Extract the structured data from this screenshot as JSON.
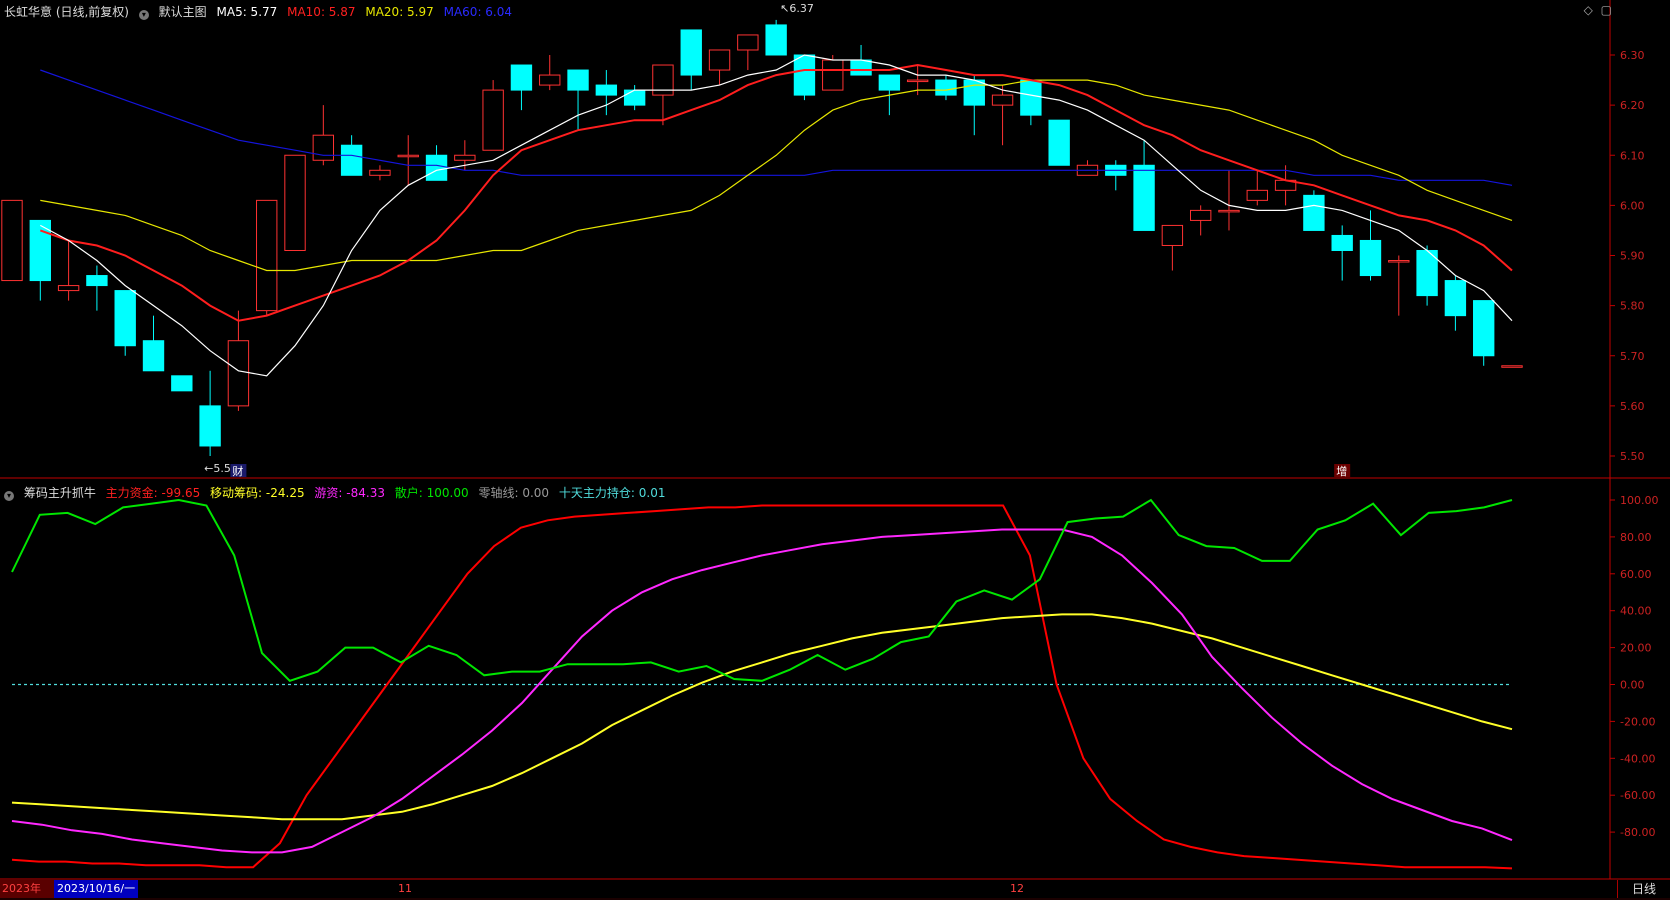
{
  "main_header": {
    "title": "长虹华意 (日线,前复权)",
    "indicator": "默认主图",
    "ma5": "MA5: 5.77",
    "ma10": "MA10: 5.87",
    "ma20": "MA20: 5.97",
    "ma60": "MA60: 6.04"
  },
  "sub_header": {
    "name": "筹码主升抓牛",
    "main_fund": "主力资金: -99.65",
    "moving_chips": "移动筹码: -24.25",
    "hot_money": "游资: -84.33",
    "retail": "散户: 100.00",
    "zero_line": "零轴线: 0.00",
    "ten_day_hold": "十天主力持仓: 0.01"
  },
  "corner_icons": [
    "diamond-icon",
    "square-icon"
  ],
  "date_band": {
    "year": "2023年",
    "cursor_date": "2023/10/16/一",
    "month_11": "11",
    "month_12": "12"
  },
  "period_label": "日线",
  "colors": {
    "up": "#ff3232",
    "down": "#00ffff",
    "ma5": "#ffffff",
    "ma10": "#ff1e1e",
    "ma20": "#e6e600",
    "ma60": "#1414dc",
    "main_fund": "#ff0000",
    "moving_chips": "#ffff28",
    "hot_money": "#ff28ff",
    "retail": "#00e600",
    "zero_line": "#50dcdc",
    "axis": "#c00000"
  },
  "chart_data": [
    {
      "type": "candlestick",
      "price_axis": {
        "min": 5.45,
        "max": 6.37,
        "ticks": [
          "6.30",
          "6.20",
          "6.10",
          "6.00",
          "5.90",
          "5.80",
          "5.70",
          "5.60",
          "5.50"
        ]
      },
      "annotations": {
        "high": "6.37",
        "low": "5.50",
        "event_caicai": "财",
        "event_zeng": "增"
      },
      "candles": [
        {
          "o": 5.85,
          "h": 5.97,
          "l": 5.85,
          "c": 6.01
        },
        {
          "o": 5.97,
          "h": 5.97,
          "l": 5.81,
          "c": 5.85
        },
        {
          "o": 5.83,
          "h": 5.93,
          "l": 5.81,
          "c": 5.84
        },
        {
          "o": 5.86,
          "h": 5.88,
          "l": 5.79,
          "c": 5.84
        },
        {
          "o": 5.83,
          "h": 5.83,
          "l": 5.7,
          "c": 5.72
        },
        {
          "o": 5.73,
          "h": 5.78,
          "l": 5.68,
          "c": 5.67
        },
        {
          "o": 5.66,
          "h": 5.66,
          "l": 5.63,
          "c": 5.63
        },
        {
          "o": 5.6,
          "h": 5.67,
          "l": 5.5,
          "c": 5.52
        },
        {
          "o": 5.6,
          "h": 5.79,
          "l": 5.59,
          "c": 5.73
        },
        {
          "o": 5.79,
          "h": 6.0,
          "l": 5.78,
          "c": 6.01
        },
        {
          "o": 5.91,
          "h": 6.1,
          "l": 5.91,
          "c": 6.1
        },
        {
          "o": 6.09,
          "h": 6.2,
          "l": 6.08,
          "c": 6.14
        },
        {
          "o": 6.12,
          "h": 6.14,
          "l": 6.06,
          "c": 6.06
        },
        {
          "o": 6.06,
          "h": 6.08,
          "l": 6.05,
          "c": 6.07
        },
        {
          "o": 6.1,
          "h": 6.14,
          "l": 6.04,
          "c": 6.1
        },
        {
          "o": 6.1,
          "h": 6.12,
          "l": 6.05,
          "c": 6.05
        },
        {
          "o": 6.09,
          "h": 6.13,
          "l": 6.07,
          "c": 6.1
        },
        {
          "o": 6.11,
          "h": 6.25,
          "l": 6.11,
          "c": 6.23
        },
        {
          "o": 6.28,
          "h": 6.28,
          "l": 6.19,
          "c": 6.23
        },
        {
          "o": 6.24,
          "h": 6.3,
          "l": 6.23,
          "c": 6.26
        },
        {
          "o": 6.27,
          "h": 6.26,
          "l": 6.15,
          "c": 6.23
        },
        {
          "o": 6.24,
          "h": 6.27,
          "l": 6.18,
          "c": 6.22
        },
        {
          "o": 6.23,
          "h": 6.24,
          "l": 6.19,
          "c": 6.2
        },
        {
          "o": 6.22,
          "h": 6.27,
          "l": 6.16,
          "c": 6.28
        },
        {
          "o": 6.35,
          "h": 6.35,
          "l": 6.23,
          "c": 6.26
        },
        {
          "o": 6.27,
          "h": 6.31,
          "l": 6.24,
          "c": 6.31
        },
        {
          "o": 6.31,
          "h": 6.34,
          "l": 6.27,
          "c": 6.34
        },
        {
          "o": 6.36,
          "h": 6.37,
          "l": 6.3,
          "c": 6.3
        },
        {
          "o": 6.3,
          "h": 6.3,
          "l": 6.21,
          "c": 6.22
        },
        {
          "o": 6.23,
          "h": 6.3,
          "l": 6.23,
          "c": 6.29
        },
        {
          "o": 6.29,
          "h": 6.32,
          "l": 6.26,
          "c": 6.26
        },
        {
          "o": 6.26,
          "h": 6.26,
          "l": 6.18,
          "c": 6.23
        },
        {
          "o": 6.25,
          "h": 6.28,
          "l": 6.22,
          "c": 6.25
        },
        {
          "o": 6.25,
          "h": 6.26,
          "l": 6.21,
          "c": 6.22
        },
        {
          "o": 6.25,
          "h": 6.26,
          "l": 6.14,
          "c": 6.2
        },
        {
          "o": 6.2,
          "h": 6.24,
          "l": 6.12,
          "c": 6.22
        },
        {
          "o": 6.25,
          "h": 6.25,
          "l": 6.16,
          "c": 6.18
        },
        {
          "o": 6.17,
          "h": 6.17,
          "l": 6.08,
          "c": 6.08
        },
        {
          "o": 6.06,
          "h": 6.09,
          "l": 6.06,
          "c": 6.08
        },
        {
          "o": 6.08,
          "h": 6.09,
          "l": 6.03,
          "c": 6.06
        },
        {
          "o": 6.08,
          "h": 6.13,
          "l": 5.95,
          "c": 5.95
        },
        {
          "o": 5.92,
          "h": 5.96,
          "l": 5.87,
          "c": 5.96
        },
        {
          "o": 5.97,
          "h": 6.0,
          "l": 5.94,
          "c": 5.99
        },
        {
          "o": 5.99,
          "h": 6.07,
          "l": 5.95,
          "c": 5.99
        },
        {
          "o": 6.01,
          "h": 6.07,
          "l": 6.0,
          "c": 6.03
        },
        {
          "o": 6.03,
          "h": 6.08,
          "l": 6.0,
          "c": 6.05
        },
        {
          "o": 6.02,
          "h": 6.03,
          "l": 5.95,
          "c": 5.95
        },
        {
          "o": 5.94,
          "h": 5.96,
          "l": 5.85,
          "c": 5.91
        },
        {
          "o": 5.93,
          "h": 5.99,
          "l": 5.85,
          "c": 5.86
        },
        {
          "o": 5.89,
          "h": 5.9,
          "l": 5.78,
          "c": 5.89
        },
        {
          "o": 5.91,
          "h": 5.92,
          "l": 5.8,
          "c": 5.82
        },
        {
          "o": 5.85,
          "h": 5.86,
          "l": 5.75,
          "c": 5.78
        },
        {
          "o": 5.81,
          "h": 5.81,
          "l": 5.68,
          "c": 5.7
        },
        {
          "o": 5.68,
          "h": 5.68,
          "l": 5.68,
          "c": 5.68
        }
      ],
      "ma5": [
        5.96,
        5.93,
        5.89,
        5.84,
        5.8,
        5.76,
        5.71,
        5.67,
        5.66,
        5.72,
        5.8,
        5.91,
        5.99,
        6.04,
        6.07,
        6.08,
        6.09,
        6.12,
        6.15,
        6.18,
        6.2,
        6.23,
        6.23,
        6.23,
        6.24,
        6.26,
        6.27,
        6.3,
        6.29,
        6.29,
        6.28,
        6.26,
        6.26,
        6.25,
        6.23,
        6.22,
        6.21,
        6.19,
        6.16,
        6.13,
        6.08,
        6.03,
        6.0,
        5.99,
        5.99,
        6.0,
        5.99,
        5.97,
        5.95,
        5.91,
        5.86,
        5.83,
        5.77
      ],
      "ma10": [
        5.95,
        5.93,
        5.92,
        5.9,
        5.87,
        5.84,
        5.8,
        5.77,
        5.78,
        5.8,
        5.82,
        5.84,
        5.86,
        5.89,
        5.93,
        5.99,
        6.06,
        6.11,
        6.13,
        6.15,
        6.16,
        6.17,
        6.17,
        6.19,
        6.21,
        6.24,
        6.26,
        6.27,
        6.27,
        6.27,
        6.27,
        6.28,
        6.27,
        6.26,
        6.26,
        6.25,
        6.24,
        6.22,
        6.19,
        6.16,
        6.14,
        6.11,
        6.09,
        6.07,
        6.05,
        6.04,
        6.02,
        6.0,
        5.98,
        5.97,
        5.95,
        5.92,
        5.87
      ],
      "ma20": [
        6.01,
        6.0,
        5.99,
        5.98,
        5.96,
        5.94,
        5.91,
        5.89,
        5.87,
        5.87,
        5.88,
        5.89,
        5.89,
        5.89,
        5.89,
        5.9,
        5.91,
        5.91,
        5.93,
        5.95,
        5.96,
        5.97,
        5.98,
        5.99,
        6.02,
        6.06,
        6.1,
        6.15,
        6.19,
        6.21,
        6.22,
        6.23,
        6.23,
        6.24,
        6.24,
        6.25,
        6.25,
        6.25,
        6.24,
        6.22,
        6.21,
        6.2,
        6.19,
        6.17,
        6.15,
        6.13,
        6.1,
        6.08,
        6.06,
        6.03,
        6.01,
        5.99,
        5.97
      ],
      "ma60": [
        6.27,
        6.25,
        6.23,
        6.21,
        6.19,
        6.17,
        6.15,
        6.13,
        6.12,
        6.11,
        6.1,
        6.1,
        6.09,
        6.08,
        6.08,
        6.07,
        6.07,
        6.06,
        6.06,
        6.06,
        6.06,
        6.06,
        6.06,
        6.06,
        6.06,
        6.06,
        6.06,
        6.06,
        6.07,
        6.07,
        6.07,
        6.07,
        6.07,
        6.07,
        6.07,
        6.07,
        6.07,
        6.07,
        6.07,
        6.07,
        6.07,
        6.07,
        6.07,
        6.07,
        6.07,
        6.06,
        6.06,
        6.06,
        6.05,
        6.05,
        6.05,
        6.05,
        6.04
      ]
    },
    {
      "type": "line",
      "indicator_axis": {
        "min": -100,
        "max": 100,
        "ticks": [
          "100.00",
          "80.00",
          "60.00",
          "40.00",
          "20.00",
          "0.00",
          "-20.00",
          "-40.00",
          "-60.00",
          "-80.00"
        ]
      },
      "series": [
        {
          "name": "主力资金",
          "values": [
            -95,
            -96,
            -96,
            -97,
            -97,
            -98,
            -98,
            -98,
            -99,
            -99,
            -86,
            -60,
            -40,
            -20,
            0,
            20,
            40,
            60,
            75,
            85,
            89,
            91,
            92,
            93,
            94,
            95,
            96,
            96,
            97,
            97,
            97,
            97,
            97,
            97,
            97,
            97,
            97,
            97,
            70,
            0,
            -40,
            -62,
            -74,
            -84,
            -88,
            -91,
            -93,
            -94,
            -95,
            -96,
            -97,
            -98,
            -99,
            -99,
            -99,
            -99,
            -99.65
          ]
        },
        {
          "name": "移动筹码",
          "values": [
            -64,
            -65,
            -66,
            -67,
            -68,
            -69,
            -70,
            -71,
            -72,
            -73,
            -73,
            -73,
            -71,
            -69,
            -65,
            -60,
            -55,
            -48,
            -40,
            -32,
            -22,
            -14,
            -6,
            1,
            7,
            12,
            17,
            21,
            25,
            28,
            30,
            32,
            34,
            36,
            37,
            38,
            38,
            36,
            33,
            29,
            25,
            20,
            15,
            10,
            5,
            0,
            -5,
            -10,
            -15,
            -20,
            -24.25
          ]
        },
        {
          "name": "游资",
          "values": [
            -74,
            -76,
            -79,
            -81,
            -84,
            -86,
            -88,
            -90,
            -91,
            -91,
            -88,
            -80,
            -72,
            -62,
            -50,
            -38,
            -25,
            -10,
            8,
            26,
            40,
            50,
            57,
            62,
            66,
            70,
            73,
            76,
            78,
            80,
            81,
            82,
            83,
            84,
            84,
            84,
            80,
            70,
            55,
            38,
            15,
            -2,
            -18,
            -32,
            -44,
            -54,
            -62,
            -68,
            -74,
            -78,
            -84.33
          ]
        },
        {
          "name": "散户",
          "values": [
            61,
            92,
            93,
            87,
            96,
            98,
            100,
            97,
            70,
            17,
            2,
            7,
            20,
            20,
            12,
            21,
            16,
            5,
            7,
            7,
            11,
            11,
            11,
            12,
            7,
            10,
            3,
            2,
            8,
            16,
            8,
            14,
            23,
            26,
            45,
            51,
            46,
            57,
            88,
            90,
            91,
            100,
            81,
            75,
            74,
            67,
            67,
            84,
            89,
            98,
            81,
            93,
            94,
            96,
            100
          ]
        },
        {
          "name": "零轴线",
          "values": [
            0
          ]
        }
      ]
    }
  ]
}
